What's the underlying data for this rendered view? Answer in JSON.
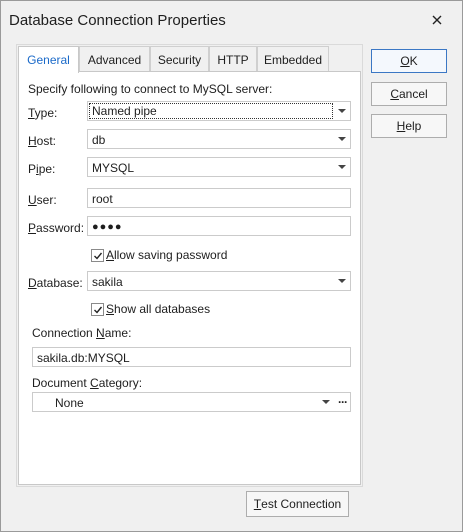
{
  "window": {
    "title": "Database Connection Properties"
  },
  "tabs": [
    {
      "label": "General",
      "active": true
    },
    {
      "label": "Advanced",
      "active": false
    },
    {
      "label": "Security",
      "active": false
    },
    {
      "label": "HTTP",
      "active": false
    },
    {
      "label": "Embedded",
      "active": false
    }
  ],
  "general": {
    "intro": "Specify following to connect to MySQL server:",
    "type": {
      "label_pre": "T",
      "label_post": "ype:",
      "value": "Named pipe"
    },
    "host": {
      "label_pre": "H",
      "label_post": "ost:",
      "value": "db"
    },
    "pipe": {
      "label_pre": "P",
      "label_ul": "i",
      "label_post": "pe:",
      "value": "MYSQL"
    },
    "user": {
      "label_pre": "U",
      "label_post": "ser:",
      "value": "root"
    },
    "password": {
      "label_pre": "P",
      "label_post": "assword:",
      "value": "●●●●"
    },
    "allow_saving": {
      "label_ul": "A",
      "label_post": "llow saving password",
      "checked": true
    },
    "database": {
      "label_pre": "D",
      "label_post": "atabase:",
      "value": "sakila"
    },
    "show_all": {
      "label_ul": "S",
      "label_post": "how all databases",
      "checked": true
    },
    "connection_name": {
      "label_pre": "Connection ",
      "label_ul": "N",
      "label_post": "ame:",
      "value": "sakila.db:MYSQL"
    },
    "document_category": {
      "label_pre": "Document ",
      "label_ul": "C",
      "label_post": "ategory:",
      "value": "None",
      "dots": "···"
    }
  },
  "buttons": {
    "ok": {
      "ul": "O",
      "rest": "K"
    },
    "cancel": {
      "ul": "C",
      "rest": "ancel"
    },
    "help": {
      "ul": "H",
      "rest": "elp"
    },
    "test": {
      "ul": "T",
      "rest": "est Connection"
    }
  }
}
